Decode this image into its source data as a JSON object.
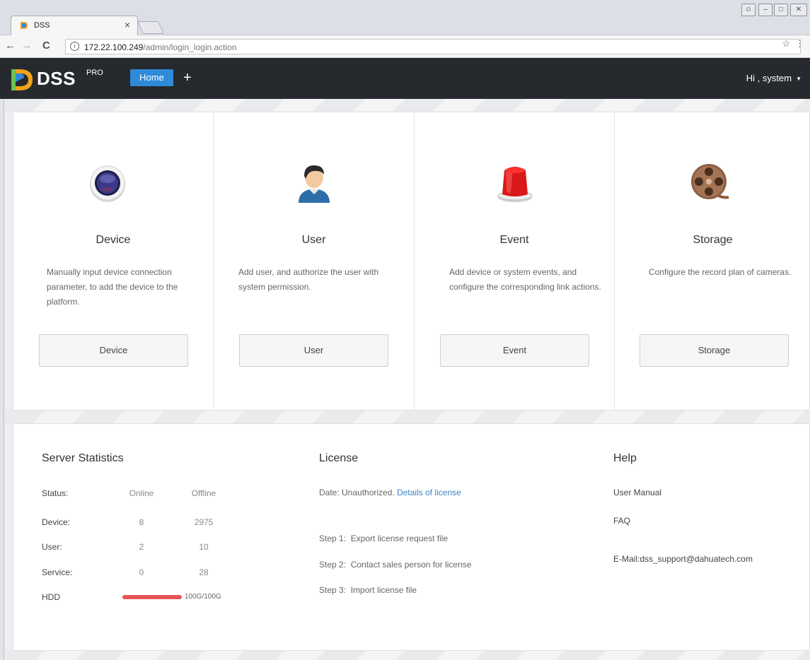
{
  "browser": {
    "tab_title": "DSS",
    "tab_close": "×",
    "url_host": "172.22.100.249",
    "url_path": "/admin/login_login.action"
  },
  "header": {
    "logo": "DSS",
    "logo_sup": "PRO",
    "tabs": [
      {
        "label": "Home"
      },
      {
        "label": "+"
      }
    ],
    "user_greeting": "Hi , system",
    "user_caret": "▼"
  },
  "cards": [
    {
      "title": "Device",
      "description": "Manually input device connection parameter, to add the device to the platform.",
      "button": "Device",
      "icon": "device-icon"
    },
    {
      "title": "User",
      "description": "Add user, and authorize the user with system permission.",
      "button": "User",
      "icon": "user-icon"
    },
    {
      "title": "Event",
      "description": "Add device or system events, and configure the corresponding link actions.",
      "button": "Event",
      "icon": "alarm-light-icon"
    },
    {
      "title": "Storage",
      "description": "Configure the record plan of cameras.",
      "button": "Storage",
      "icon": "film-reel-icon"
    }
  ],
  "server_statistics": {
    "title": "Server Statistics",
    "headers": {
      "status": "Status:",
      "online": "Online",
      "offline": "Offline"
    },
    "rows": [
      {
        "label": "Device:",
        "online": "8",
        "offline": "2975"
      },
      {
        "label": "User:",
        "online": "2",
        "offline": "10"
      },
      {
        "label": "Service:",
        "online": "0",
        "offline": "28"
      }
    ],
    "hdd": {
      "label": "HDD",
      "usage": "100G/100G",
      "fill_fraction": 1.0,
      "bar_color": "#e85454"
    }
  },
  "license": {
    "title": "License",
    "date_text": "Date: Unauthorized.",
    "details_link": "Details of license",
    "steps": [
      {
        "label": "Step 1:",
        "text": "Export license request file"
      },
      {
        "label": "Step 2:",
        "text": "Contact sales person for license"
      },
      {
        "label": "Step 3:",
        "text": "Import license file"
      }
    ]
  },
  "help": {
    "title": "Help",
    "user_manual": "User Manual",
    "faq": "FAQ",
    "email": "E-Mail:dss_support@dahuatech.com"
  },
  "colors": {
    "accent": "#2f8ad8",
    "header_bg": "#26292e",
    "link": "#3b83c8"
  }
}
